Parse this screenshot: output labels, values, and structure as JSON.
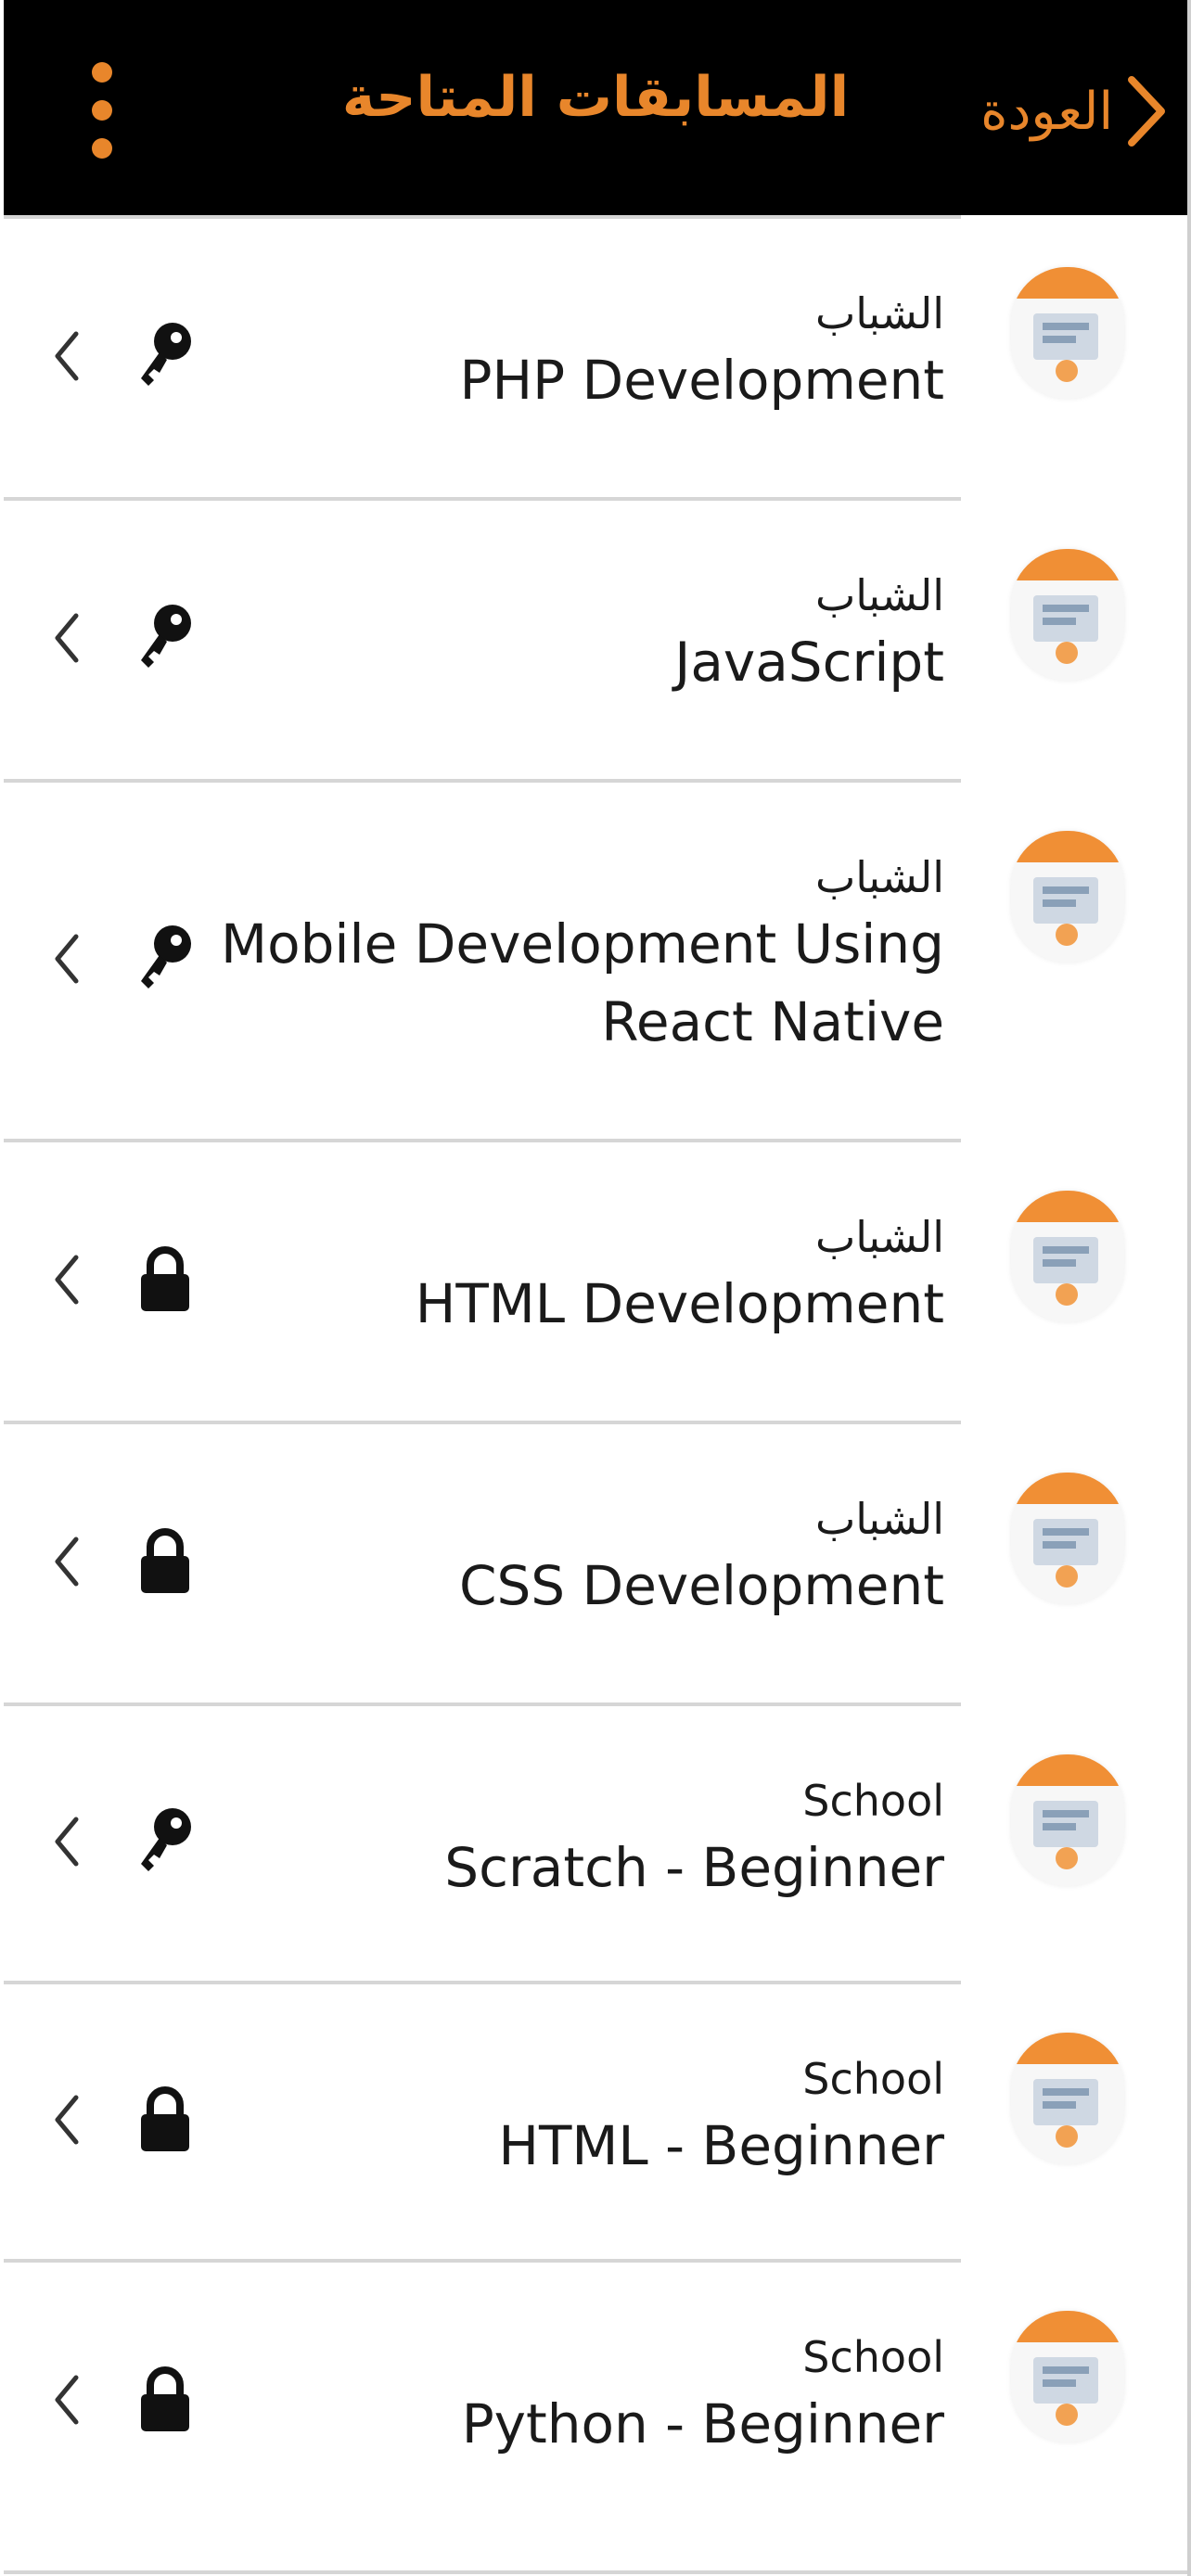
{
  "header": {
    "back_label": "العودة",
    "title": "المسابقات المتاحة",
    "accent": "#e8862b",
    "background": "#000000"
  },
  "courses": [
    {
      "category": "الشباب",
      "name": "PHP Development",
      "status_icon": "key-icon"
    },
    {
      "category": "الشباب",
      "name": "JavaScript",
      "status_icon": "key-icon"
    },
    {
      "category": "الشباب",
      "name": "Mobile Development Using React Native",
      "status_icon": "key-icon"
    },
    {
      "category": "الشباب",
      "name": "HTML Development",
      "status_icon": "lock-icon"
    },
    {
      "category": "الشباب",
      "name": "CSS Development",
      "status_icon": "lock-icon"
    },
    {
      "category": "School",
      "name": "Scratch - Beginner",
      "status_icon": "key-icon"
    },
    {
      "category": "School",
      "name": "HTML - Beginner",
      "status_icon": "lock-icon"
    },
    {
      "category": "School",
      "name": "Python - Beginner",
      "status_icon": "lock-icon"
    }
  ]
}
